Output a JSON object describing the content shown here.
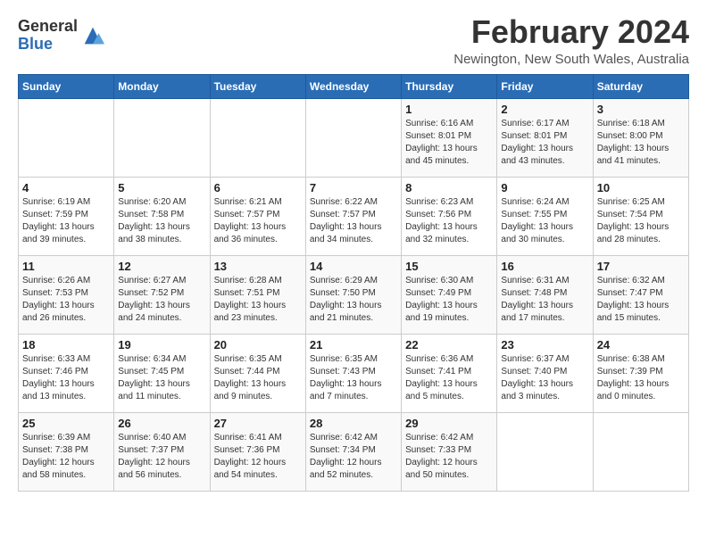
{
  "logo": {
    "general": "General",
    "blue": "Blue"
  },
  "header": {
    "month_year": "February 2024",
    "location": "Newington, New South Wales, Australia"
  },
  "days_of_week": [
    "Sunday",
    "Monday",
    "Tuesday",
    "Wednesday",
    "Thursday",
    "Friday",
    "Saturday"
  ],
  "weeks": [
    [
      {
        "day": "",
        "info": ""
      },
      {
        "day": "",
        "info": ""
      },
      {
        "day": "",
        "info": ""
      },
      {
        "day": "",
        "info": ""
      },
      {
        "day": "1",
        "info": "Sunrise: 6:16 AM\nSunset: 8:01 PM\nDaylight: 13 hours\nand 45 minutes."
      },
      {
        "day": "2",
        "info": "Sunrise: 6:17 AM\nSunset: 8:01 PM\nDaylight: 13 hours\nand 43 minutes."
      },
      {
        "day": "3",
        "info": "Sunrise: 6:18 AM\nSunset: 8:00 PM\nDaylight: 13 hours\nand 41 minutes."
      }
    ],
    [
      {
        "day": "4",
        "info": "Sunrise: 6:19 AM\nSunset: 7:59 PM\nDaylight: 13 hours\nand 39 minutes."
      },
      {
        "day": "5",
        "info": "Sunrise: 6:20 AM\nSunset: 7:58 PM\nDaylight: 13 hours\nand 38 minutes."
      },
      {
        "day": "6",
        "info": "Sunrise: 6:21 AM\nSunset: 7:57 PM\nDaylight: 13 hours\nand 36 minutes."
      },
      {
        "day": "7",
        "info": "Sunrise: 6:22 AM\nSunset: 7:57 PM\nDaylight: 13 hours\nand 34 minutes."
      },
      {
        "day": "8",
        "info": "Sunrise: 6:23 AM\nSunset: 7:56 PM\nDaylight: 13 hours\nand 32 minutes."
      },
      {
        "day": "9",
        "info": "Sunrise: 6:24 AM\nSunset: 7:55 PM\nDaylight: 13 hours\nand 30 minutes."
      },
      {
        "day": "10",
        "info": "Sunrise: 6:25 AM\nSunset: 7:54 PM\nDaylight: 13 hours\nand 28 minutes."
      }
    ],
    [
      {
        "day": "11",
        "info": "Sunrise: 6:26 AM\nSunset: 7:53 PM\nDaylight: 13 hours\nand 26 minutes."
      },
      {
        "day": "12",
        "info": "Sunrise: 6:27 AM\nSunset: 7:52 PM\nDaylight: 13 hours\nand 24 minutes."
      },
      {
        "day": "13",
        "info": "Sunrise: 6:28 AM\nSunset: 7:51 PM\nDaylight: 13 hours\nand 23 minutes."
      },
      {
        "day": "14",
        "info": "Sunrise: 6:29 AM\nSunset: 7:50 PM\nDaylight: 13 hours\nand 21 minutes."
      },
      {
        "day": "15",
        "info": "Sunrise: 6:30 AM\nSunset: 7:49 PM\nDaylight: 13 hours\nand 19 minutes."
      },
      {
        "day": "16",
        "info": "Sunrise: 6:31 AM\nSunset: 7:48 PM\nDaylight: 13 hours\nand 17 minutes."
      },
      {
        "day": "17",
        "info": "Sunrise: 6:32 AM\nSunset: 7:47 PM\nDaylight: 13 hours\nand 15 minutes."
      }
    ],
    [
      {
        "day": "18",
        "info": "Sunrise: 6:33 AM\nSunset: 7:46 PM\nDaylight: 13 hours\nand 13 minutes."
      },
      {
        "day": "19",
        "info": "Sunrise: 6:34 AM\nSunset: 7:45 PM\nDaylight: 13 hours\nand 11 minutes."
      },
      {
        "day": "20",
        "info": "Sunrise: 6:35 AM\nSunset: 7:44 PM\nDaylight: 13 hours\nand 9 minutes."
      },
      {
        "day": "21",
        "info": "Sunrise: 6:35 AM\nSunset: 7:43 PM\nDaylight: 13 hours\nand 7 minutes."
      },
      {
        "day": "22",
        "info": "Sunrise: 6:36 AM\nSunset: 7:41 PM\nDaylight: 13 hours\nand 5 minutes."
      },
      {
        "day": "23",
        "info": "Sunrise: 6:37 AM\nSunset: 7:40 PM\nDaylight: 13 hours\nand 3 minutes."
      },
      {
        "day": "24",
        "info": "Sunrise: 6:38 AM\nSunset: 7:39 PM\nDaylight: 13 hours\nand 0 minutes."
      }
    ],
    [
      {
        "day": "25",
        "info": "Sunrise: 6:39 AM\nSunset: 7:38 PM\nDaylight: 12 hours\nand 58 minutes."
      },
      {
        "day": "26",
        "info": "Sunrise: 6:40 AM\nSunset: 7:37 PM\nDaylight: 12 hours\nand 56 minutes."
      },
      {
        "day": "27",
        "info": "Sunrise: 6:41 AM\nSunset: 7:36 PM\nDaylight: 12 hours\nand 54 minutes."
      },
      {
        "day": "28",
        "info": "Sunrise: 6:42 AM\nSunset: 7:34 PM\nDaylight: 12 hours\nand 52 minutes."
      },
      {
        "day": "29",
        "info": "Sunrise: 6:42 AM\nSunset: 7:33 PM\nDaylight: 12 hours\nand 50 minutes."
      },
      {
        "day": "",
        "info": ""
      },
      {
        "day": "",
        "info": ""
      }
    ]
  ]
}
